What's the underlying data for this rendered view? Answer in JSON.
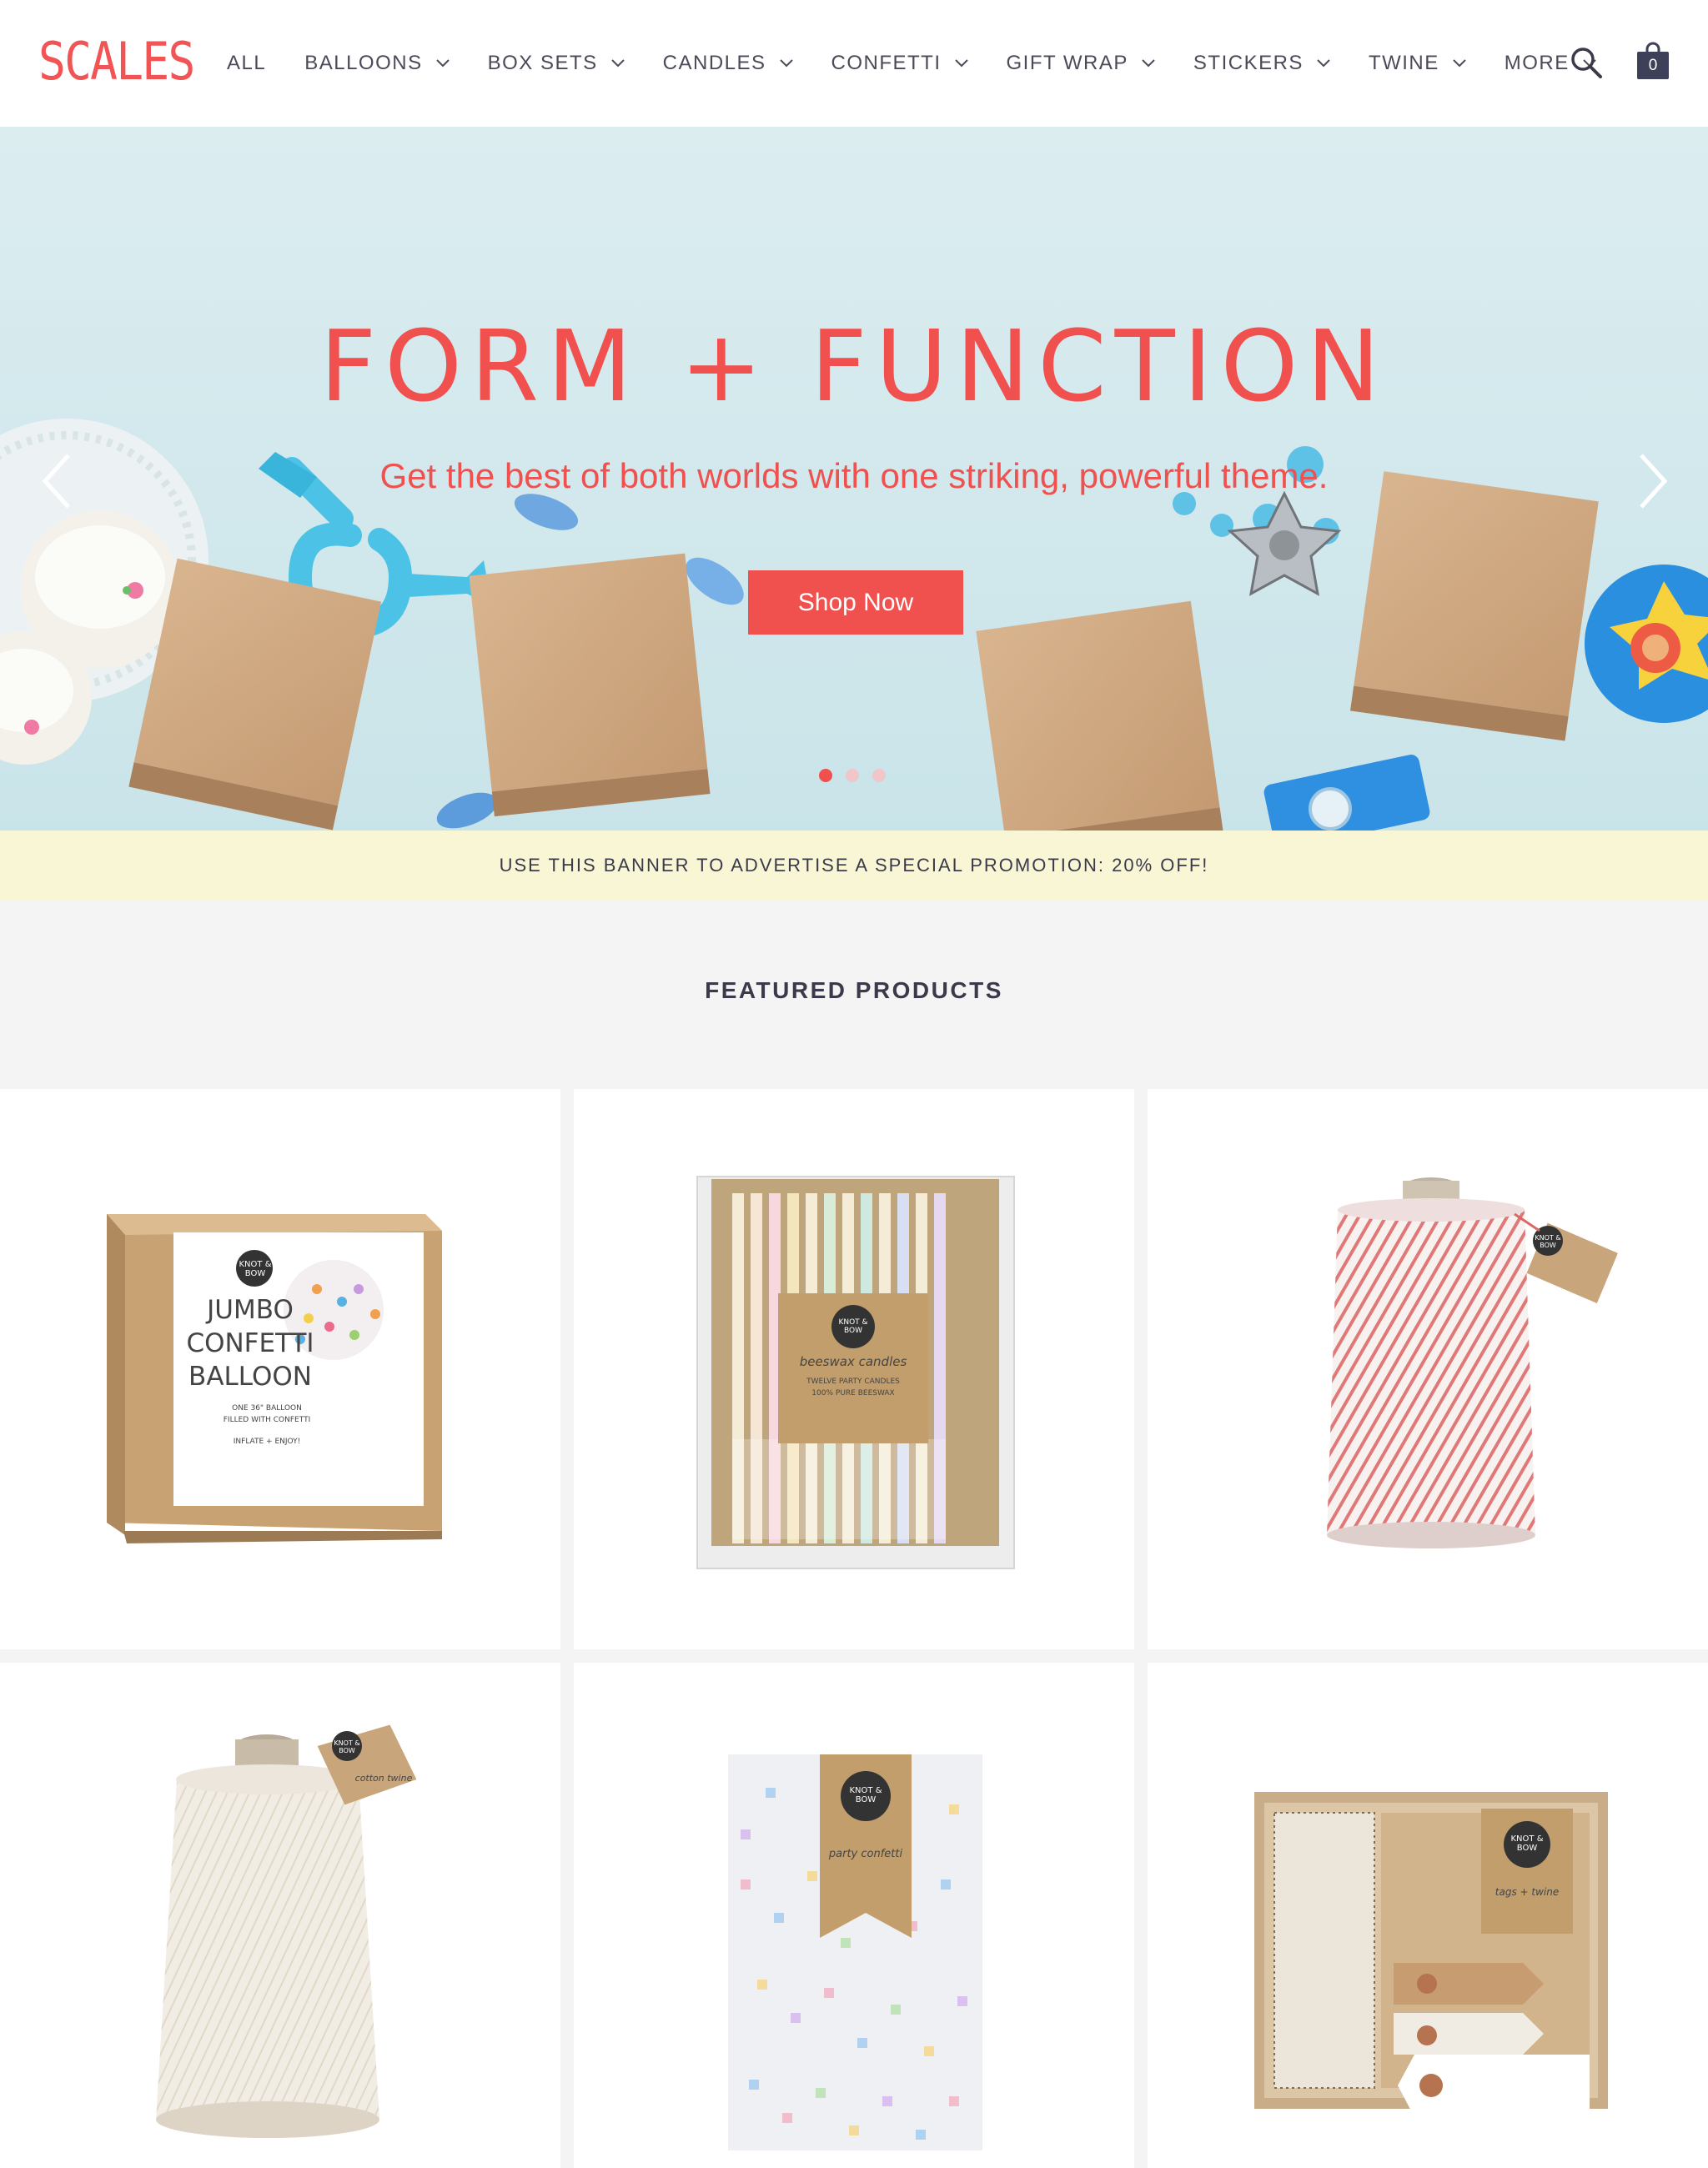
{
  "header": {
    "logo": "SCALES",
    "nav": [
      {
        "label": "ALL",
        "has_dropdown": false
      },
      {
        "label": "BALLOONS",
        "has_dropdown": true
      },
      {
        "label": "BOX SETS",
        "has_dropdown": true
      },
      {
        "label": "CANDLES",
        "has_dropdown": true
      },
      {
        "label": "CONFETTI",
        "has_dropdown": true
      },
      {
        "label": "GIFT WRAP",
        "has_dropdown": true
      },
      {
        "label": "STICKERS",
        "has_dropdown": true
      },
      {
        "label": "TWINE",
        "has_dropdown": true
      },
      {
        "label": "MORE",
        "has_dropdown": true
      }
    ],
    "search_icon": "search-icon",
    "cart_icon": "shopping-bag-icon",
    "cart_count": "0"
  },
  "hero": {
    "title": "FORM + FUNCTION",
    "subtitle": "Get the best of both worlds with one striking, powerful theme.",
    "cta_label": "Shop Now",
    "prev_icon": "chevron-left-icon",
    "next_icon": "chevron-right-icon",
    "slides": 3,
    "active_slide": 1
  },
  "promo": {
    "text": "USE THIS BANNER TO ADVERTISE A SPECIAL PROMOTION: 20% OFF!"
  },
  "featured": {
    "title": "FEATURED PRODUCTS",
    "products": [
      {
        "image": "jumbo-confetti-balloon-box",
        "package_text": [
          "KNOT & BOW",
          "JUMBO",
          "CONFETTI",
          "BALLOON",
          "ONE 36\" BALLOON",
          "FILLED WITH CONFETTI",
          "INFLATE + ENJOY!"
        ]
      },
      {
        "image": "beeswax-candles-pack",
        "package_text": [
          "KNOT & BOW",
          "beeswax candles",
          "TWELVE PARTY CANDLES",
          "100% PURE BEESWAX"
        ]
      },
      {
        "image": "red-white-twine-spool",
        "package_text": [
          "KNOT & BOW"
        ]
      },
      {
        "image": "cotton-twine-spool",
        "package_text": [
          "KNOT & BOW",
          "cotton twine"
        ]
      },
      {
        "image": "party-confetti-bag",
        "package_text": [
          "KNOT & BOW",
          "party confetti"
        ]
      },
      {
        "image": "tags-and-twine-box",
        "package_text": [
          "KNOT & BOW",
          "tags + twine"
        ]
      }
    ]
  },
  "colors": {
    "accent": "#f0504e",
    "promo_bg": "#f9f6d6",
    "hero_bg": "#d5ebef",
    "featured_bg": "#f4f4f4",
    "text": "#3a3a4a"
  }
}
